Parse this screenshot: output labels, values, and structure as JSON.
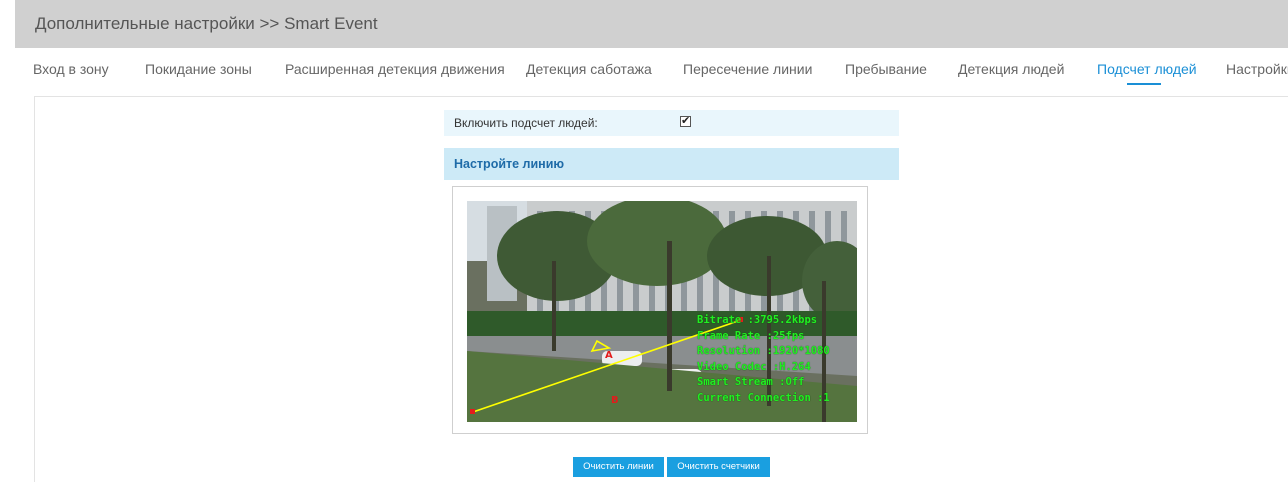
{
  "header": {
    "title": "Дополнительные настройки >> Smart Event"
  },
  "tabs": [
    {
      "label": "Вход в зону"
    },
    {
      "label": "Покидание зоны"
    },
    {
      "label": "Расширенная детекция движения"
    },
    {
      "label": "Детекция саботажа"
    },
    {
      "label": "Пересечение линии"
    },
    {
      "label": "Пребывание"
    },
    {
      "label": "Детекция людей"
    },
    {
      "label": "Подсчет людей",
      "active": true
    },
    {
      "label": "Настройки"
    }
  ],
  "people_counting": {
    "enable_label": "Включить подсчет людей:",
    "enabled": true,
    "check_glyph": "✔"
  },
  "section": {
    "title": "Настройте линию"
  },
  "video_osd": [
    "Bitrate :3795.2kbps",
    "Frame Rate :25fps",
    "Resolution :1920*1080",
    "Video Codec :H.264",
    "Smart Stream :Off",
    "Current Connection :1"
  ],
  "buttons": {
    "clear_lines": "Очистить линии",
    "clear_counters": "Очистить счетчики"
  },
  "colors": {
    "accent": "#1a8fd6",
    "button": "#1a9fe0",
    "line": "#ffff00",
    "osd_text": "#22ee22"
  }
}
